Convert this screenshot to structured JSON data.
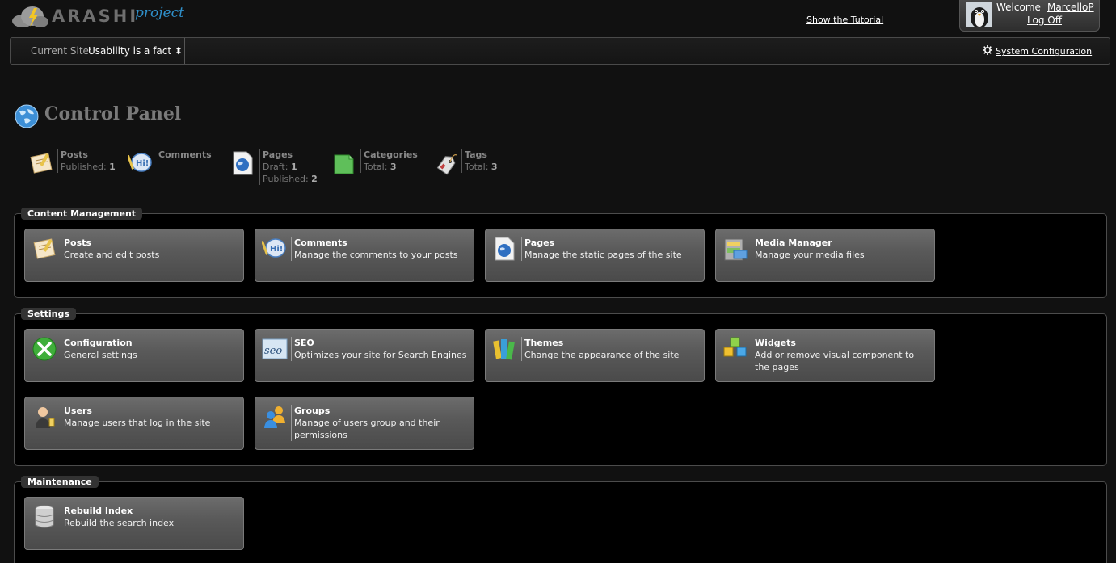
{
  "header": {
    "logo_text": "ARASHI",
    "logo_sub": "project",
    "tutorial_link": "Show the Tutorial",
    "welcome": "Welcome",
    "username": "MarcelloP",
    "logoff": "Log Off"
  },
  "sitebar": {
    "current_site_label": "Current Site:",
    "current_site_value": "Usability is a fact ⬍",
    "system_config": "System Configuration"
  },
  "page_title": "Control Panel",
  "stats": [
    {
      "name": "Posts",
      "line1": "Published:",
      "v1": "1",
      "line2": "",
      "v2": "",
      "icon": "posts-icon"
    },
    {
      "name": "Comments",
      "line1": "",
      "v1": "",
      "line2": "",
      "v2": "",
      "icon": "comments-icon"
    },
    {
      "name": "Pages",
      "line1": "Draft:",
      "v1": "1",
      "line2": "Published:",
      "v2": "2",
      "icon": "pages-icon"
    },
    {
      "name": "Categories",
      "line1": "Total:",
      "v1": "3",
      "line2": "",
      "v2": "",
      "icon": "categories-icon"
    },
    {
      "name": "Tags",
      "line1": "Total:",
      "v1": "3",
      "line2": "",
      "v2": "",
      "icon": "tags-icon"
    }
  ],
  "groups": {
    "content": {
      "title": "Content Management",
      "tiles": [
        {
          "title": "Posts",
          "desc": "Create and edit posts"
        },
        {
          "title": "Comments",
          "desc": "Manage the comments to your posts"
        },
        {
          "title": "Pages",
          "desc": "Manage the static pages of the site"
        },
        {
          "title": "Media Manager",
          "desc": "Manage your media files"
        }
      ]
    },
    "settings": {
      "title": "Settings",
      "tiles": [
        {
          "title": "Configuration",
          "desc": "General settings"
        },
        {
          "title": "SEO",
          "desc": "Optimizes your site for Search Engines"
        },
        {
          "title": "Themes",
          "desc": "Change the appearance of the site"
        },
        {
          "title": "Widgets",
          "desc": "Add or remove visual component to the pages"
        },
        {
          "title": "Users",
          "desc": "Manage users that log in the site"
        },
        {
          "title": "Groups",
          "desc": "Manage of users group and their permissions"
        }
      ]
    },
    "maintenance": {
      "title": "Maintenance",
      "tiles": [
        {
          "title": "Rebuild Index",
          "desc": "Rebuild the search index"
        }
      ]
    }
  },
  "colors": {
    "background": "#111111",
    "tile": "#5f5f5f",
    "accent_blue": "#2f8fc9"
  }
}
